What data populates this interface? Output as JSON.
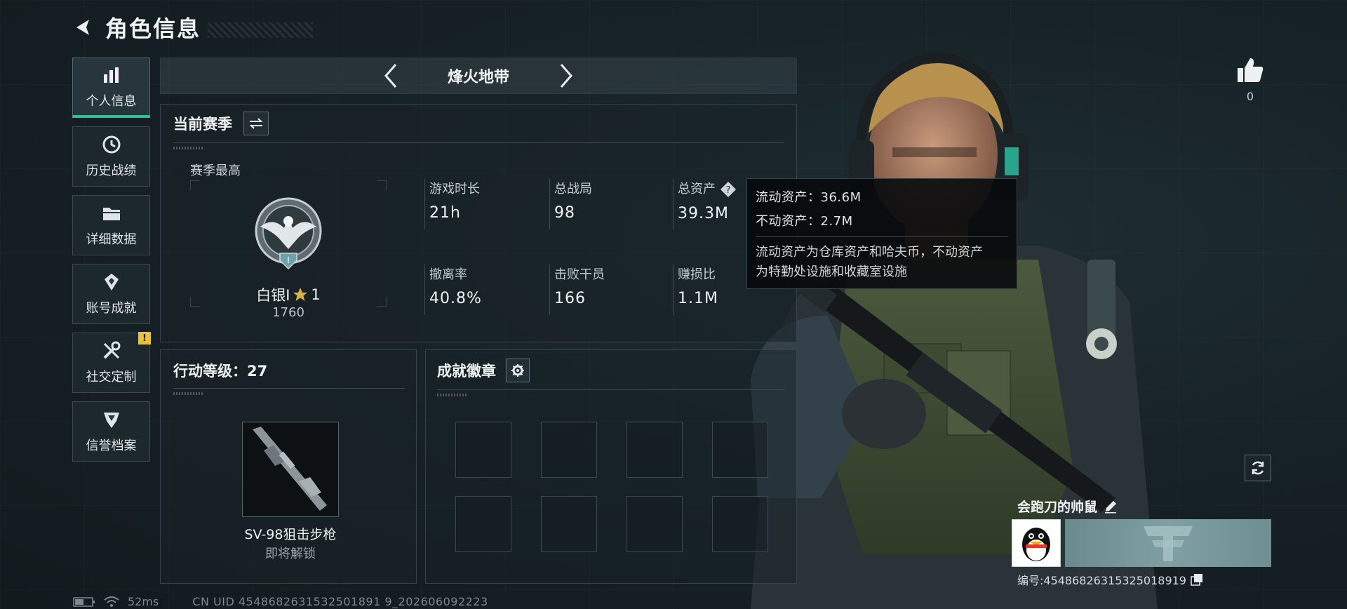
{
  "header": {
    "title": "角色信息",
    "back_icon": "back-arrow-icon"
  },
  "sidebar": {
    "items": [
      {
        "label": "个人信息",
        "icon": "bar-chart-icon",
        "active": true
      },
      {
        "label": "历史战绩",
        "icon": "history-clock-icon"
      },
      {
        "label": "详细数据",
        "icon": "folder-icon"
      },
      {
        "label": "账号成就",
        "icon": "achievement-icon"
      },
      {
        "label": "社交定制",
        "icon": "tools-icon",
        "badge": "!"
      },
      {
        "label": "信誉档案",
        "icon": "shield-icon"
      }
    ]
  },
  "mode": {
    "name": "烽火地带"
  },
  "season": {
    "title": "当前赛季",
    "best_label": "赛季最高",
    "rank_name": "白银I",
    "rank_stars": "1",
    "rank_points": "1760",
    "rank_level": "I",
    "stats": [
      {
        "label": "游戏时长",
        "value": "21h"
      },
      {
        "label": "总战局",
        "value": "98"
      },
      {
        "label": "总资产",
        "value": "39.3M",
        "has_help": true
      },
      {
        "label": "撤离率",
        "value": "40.8%"
      },
      {
        "label": "击败干员",
        "value": "166"
      },
      {
        "label": "赚损比",
        "value": "1.1M"
      }
    ]
  },
  "tooltip": {
    "liquid": "流动资产：36.6M",
    "fixed": "不动资产：2.7M",
    "desc_line1": "流动资产为仓库资产和哈夫币，不动资产",
    "desc_line2": "为特勤处设施和收藏室设施"
  },
  "level": {
    "title": "行动等级：27",
    "weapon_name": "SV-98狙击步枪",
    "weapon_status": "即将解锁"
  },
  "badges": {
    "title": "成就徽章",
    "slots": 8
  },
  "profile": {
    "likes": "0",
    "player_name": "会跑刀的帅鼠",
    "player_id": "编号:4548682631532501891​9"
  },
  "status_bar": {
    "ping": "52ms",
    "uid": "CN UID 4548682631532501891 9_202606092223"
  },
  "colors": {
    "accent": "#2fc28d",
    "badge": "#e8c33a",
    "panel_border": "#34444a"
  }
}
